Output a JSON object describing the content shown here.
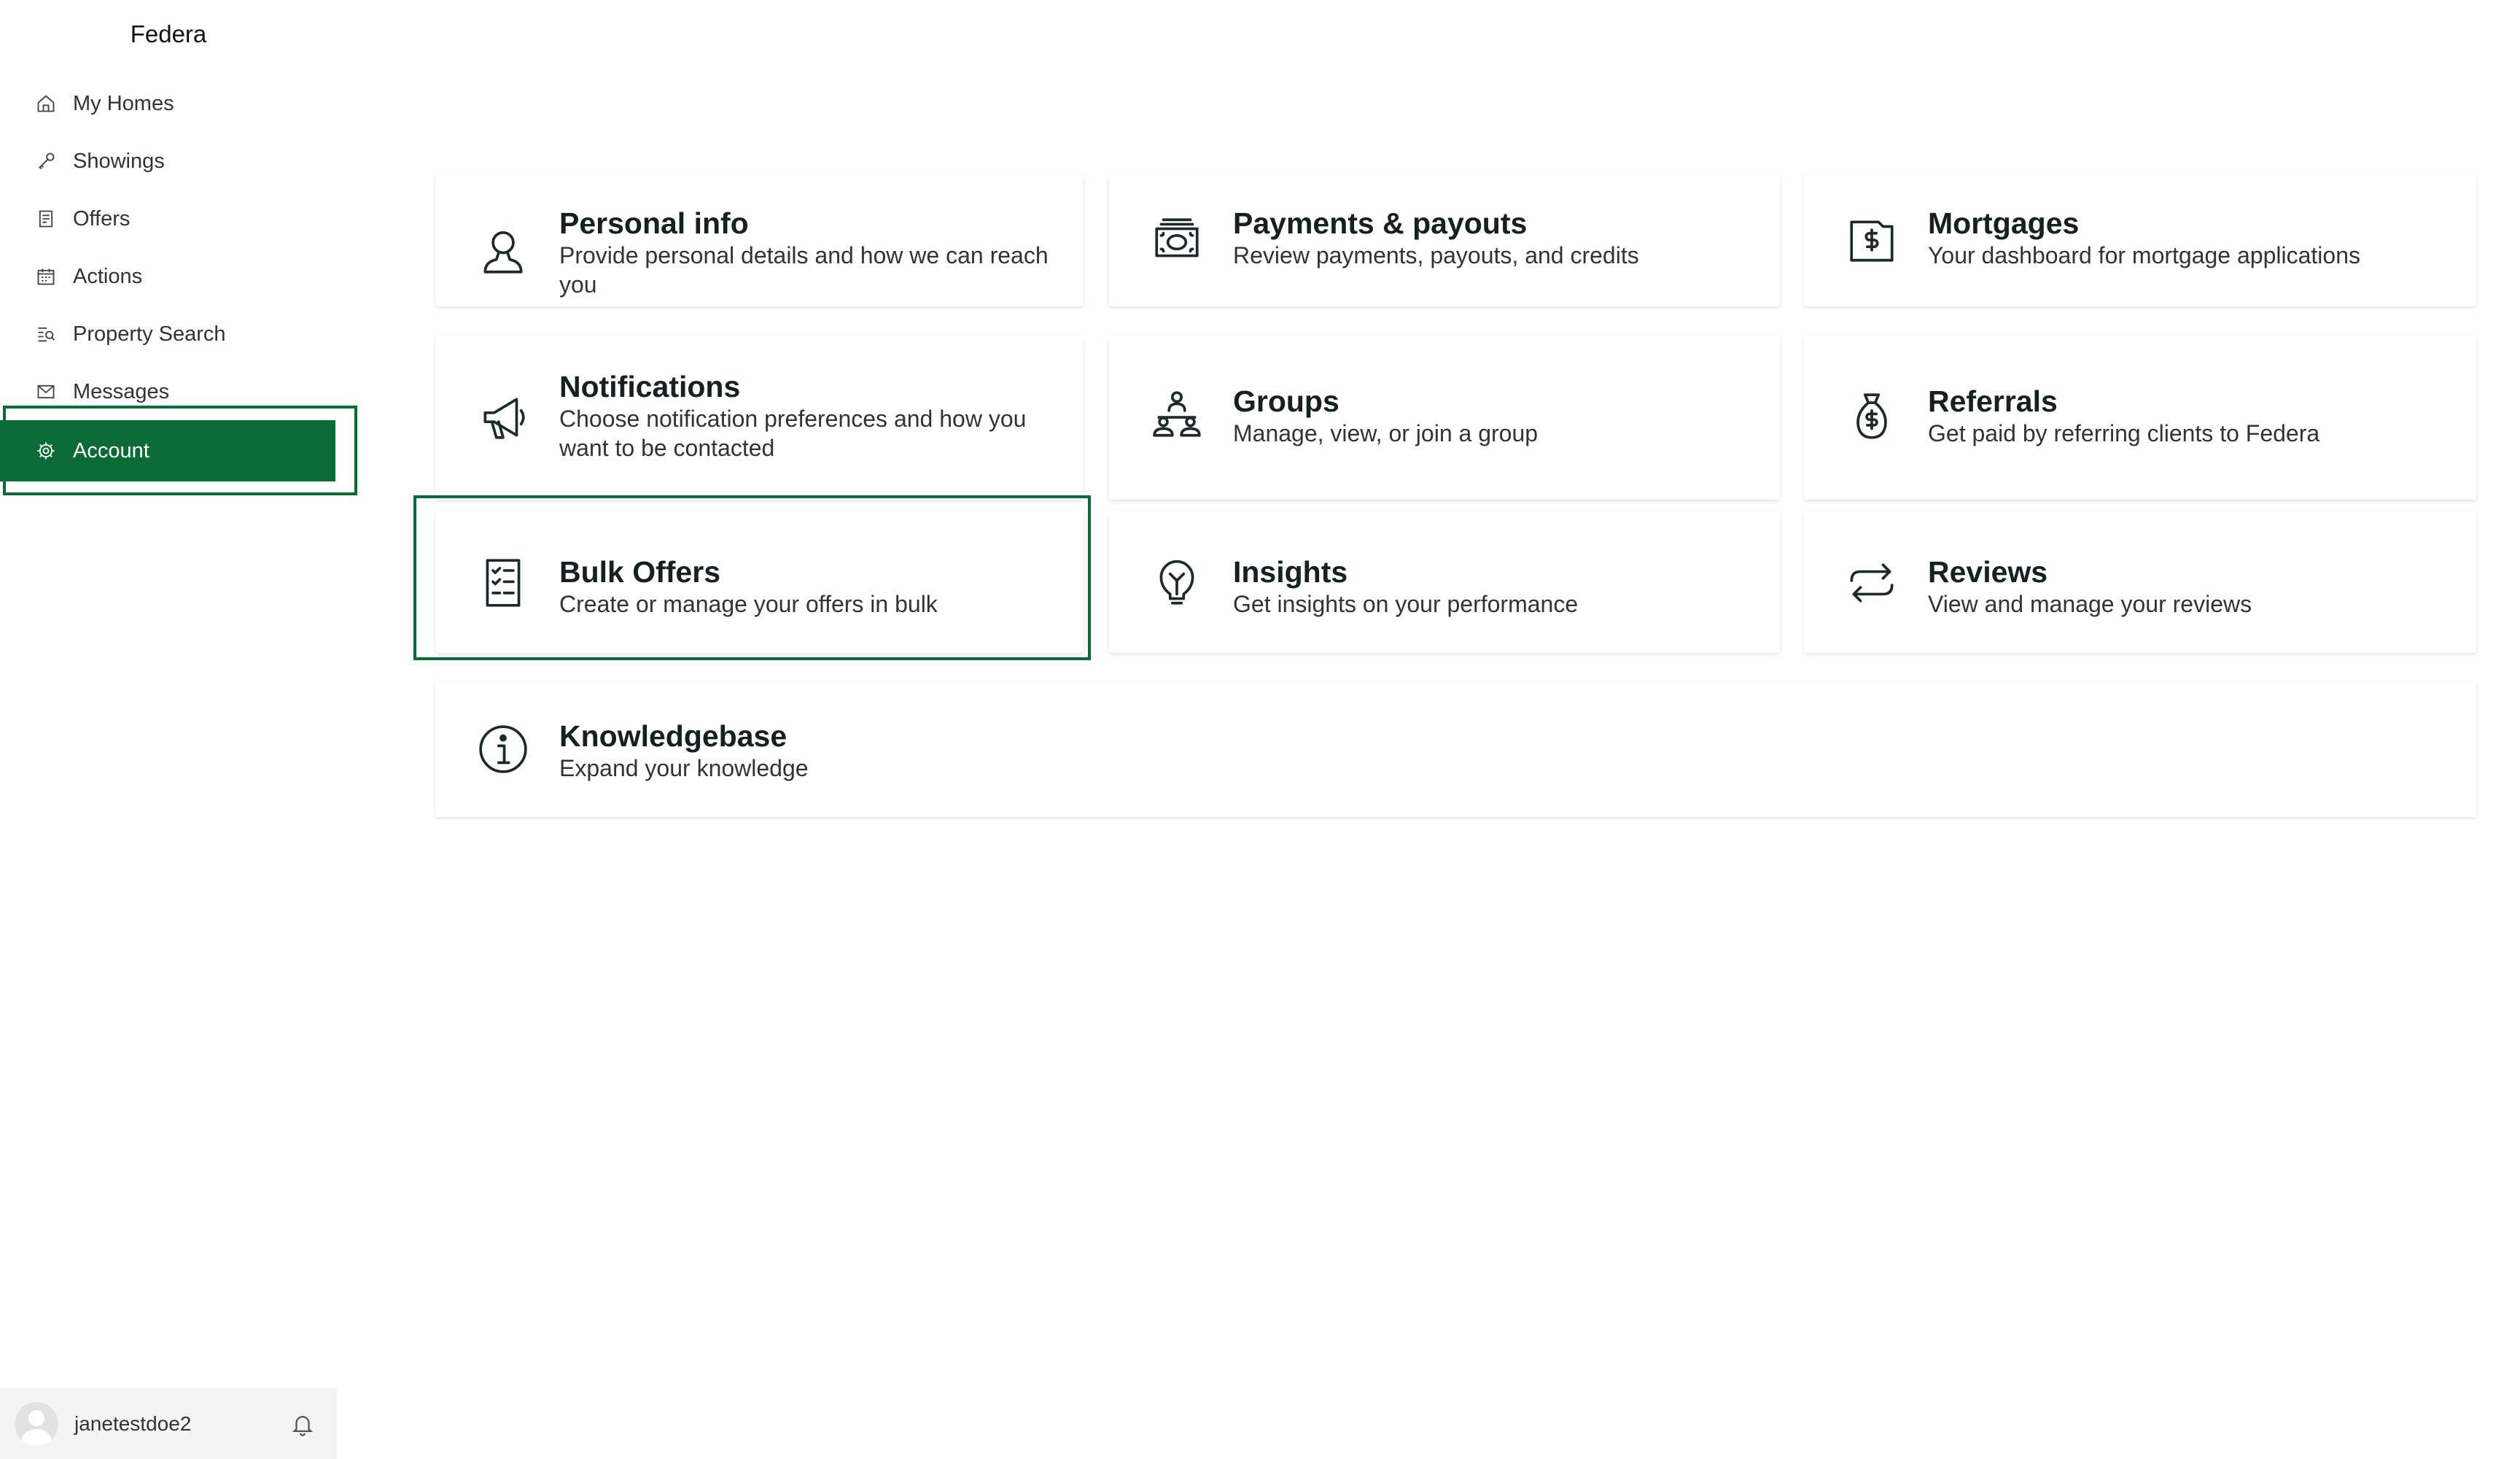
{
  "app": {
    "brand": "Federa"
  },
  "sidebar": {
    "items": [
      {
        "label": "My Homes",
        "icon": "home-icon"
      },
      {
        "label": "Showings",
        "icon": "key-icon"
      },
      {
        "label": "Offers",
        "icon": "document-icon"
      },
      {
        "label": "Actions",
        "icon": "calendar-icon"
      },
      {
        "label": "Property Search",
        "icon": "search-list-icon"
      },
      {
        "label": "Messages",
        "icon": "mail-icon"
      },
      {
        "label": "Account",
        "icon": "gear-icon",
        "active": true
      }
    ]
  },
  "user": {
    "username": "janetestdoe2"
  },
  "cards": [
    {
      "title": "Personal info",
      "desc": "Provide personal details and how we can reach you",
      "icon": "person-icon"
    },
    {
      "title": "Payments & payouts",
      "desc": "Review payments, payouts, and credits",
      "icon": "cash-icon"
    },
    {
      "title": "Mortgages",
      "desc": "Your dashboard for mortgage applications",
      "icon": "dollar-folder-icon"
    },
    {
      "title": "Notifications",
      "desc": "Choose notification preferences and how you want to be contacted",
      "icon": "megaphone-icon"
    },
    {
      "title": "Groups",
      "desc": "Manage, view, or join a group",
      "icon": "group-icon"
    },
    {
      "title": "Referrals",
      "desc": "Get paid by referring clients to Federa",
      "icon": "money-bag-icon"
    },
    {
      "title": "Bulk Offers",
      "desc": "Create or manage your offers in bulk",
      "icon": "checklist-icon"
    },
    {
      "title": "Insights",
      "desc": "Get insights on your performance",
      "icon": "lightbulb-icon"
    },
    {
      "title": "Reviews",
      "desc": "View and manage your reviews",
      "icon": "swap-arrows-icon"
    },
    {
      "title": "Knowledgebase",
      "desc": "Expand your knowledge",
      "icon": "info-icon"
    }
  ],
  "colors": {
    "accent": "#0b6b37",
    "sidebar_active_text": "#ffffff"
  }
}
